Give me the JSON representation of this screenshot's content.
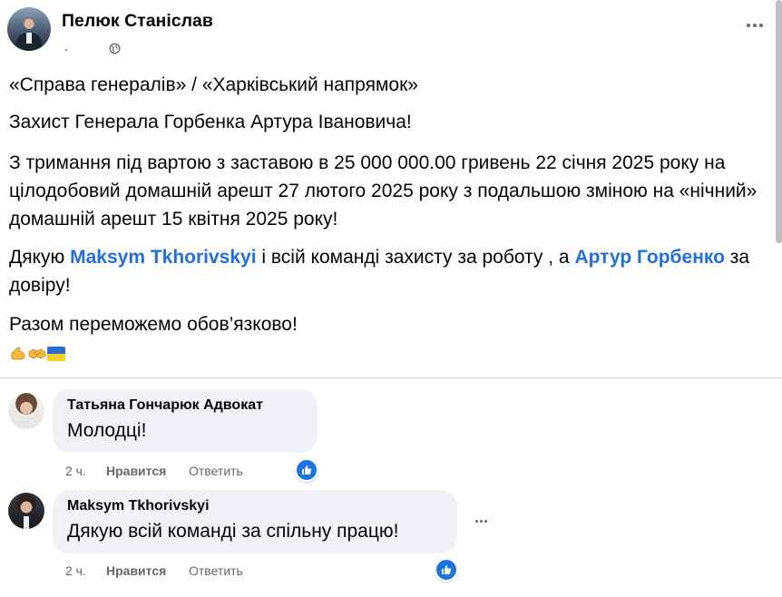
{
  "post": {
    "author": "Пелюк Станіслав",
    "paragraphs": {
      "p1": "«Справа генералів» / «Харківський напрямок»",
      "p2": "Захист Генерала Горбенка Артура Івановича!",
      "p3": "З тримання під вартою з заставою в 25 000 000.00 гривень 22 січня 2025 року на цілодобовий домашній арешт 27 лютого 2025 року з подальшою зміною на «нічний» домашній арешт 15 квітня 2025 року!",
      "p4_a": "Дякую ",
      "p4_link1": "Maksym Tkhorivskyi",
      "p4_b": " і всій команді захисту за роботу , а ",
      "p4_link2": "Артур Горбенко",
      "p4_c": " за довіру!",
      "p5": "Разом переможемо обов’язково!"
    },
    "emojis": [
      "flexed-biceps",
      "handshake",
      "ukraine-flag"
    ]
  },
  "comments": [
    {
      "author": "Татьяна Гончарюк Адвокат",
      "text": "Молодці!",
      "time": "2 ч.",
      "like_label": "Нравится",
      "reply_label": "Ответить"
    },
    {
      "author": "Maksym Tkhorivskyi",
      "text": "Дякую всій команді за спільну працю!",
      "time": "2 ч.",
      "like_label": "Нравится",
      "reply_label": "Ответить"
    }
  ],
  "icons": {
    "visibility": "globe-icon",
    "more": "more-horizontal-icon",
    "reaction": "like-thumb-icon"
  },
  "colors": {
    "link": "#216fdb",
    "like_badge": "#1b74e4",
    "bubble": "#f0f2f5",
    "secondary_text": "#65676b"
  }
}
